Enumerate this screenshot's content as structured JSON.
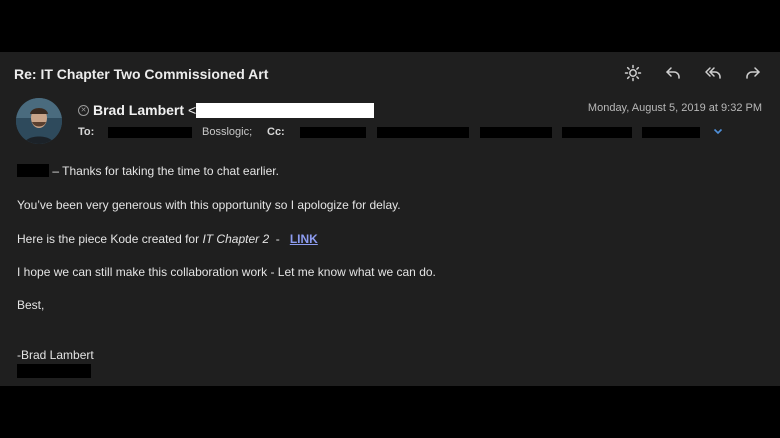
{
  "email": {
    "subject": "Re: IT Chapter Two Commissioned Art",
    "sender_name": "Brad Lambert",
    "sender_bracket": "<",
    "date": "Monday, August 5, 2019 at 9:32 PM",
    "to_label": "To:",
    "to_visible_recipient": "Bosslogic;",
    "cc_label": "Cc:"
  },
  "body": {
    "line1_rest": "– Thanks for taking the time to chat earlier.",
    "line2": "You’ve been very generous with this opportunity so I apologize for delay.",
    "line3_prefix": "Here is the piece Kode created for ",
    "line3_title": "IT Chapter 2",
    "line3_dash": "  -   ",
    "line3_link": "LINK",
    "line4": "I hope we can still make this collaboration work - Let me know what we can do.",
    "line5": "Best,",
    "signature": "-Brad Lambert"
  },
  "icons": {
    "toolbar": [
      "brightness-icon",
      "reply-icon",
      "reply-all-icon",
      "forward-icon"
    ],
    "expand": "chevron-down-icon",
    "remove_sender": "close-circle-icon"
  },
  "colors": {
    "background": "#1f1f1f",
    "link": "#8d9cf0",
    "chevron": "#4f8fd8"
  }
}
